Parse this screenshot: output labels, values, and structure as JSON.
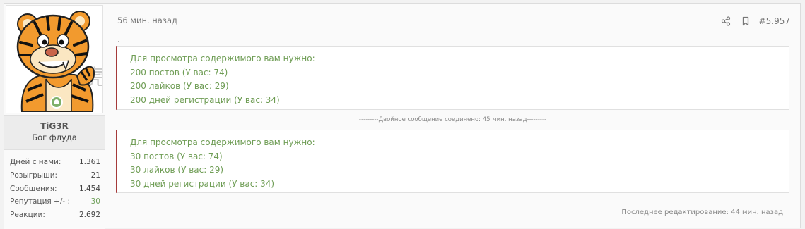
{
  "user": {
    "name": "TiG3R",
    "title": "Бог флуда",
    "online": true,
    "stats": [
      {
        "label": "Дней с нами:",
        "value": "1.361"
      },
      {
        "label": "Розыгрыши:",
        "value": "21"
      },
      {
        "label": "Сообщения:",
        "value": "1.454"
      },
      {
        "label": "Репутация +/- :",
        "value": "30",
        "color": "#6fa05a"
      },
      {
        "label": "Реакции:",
        "value": "2.692"
      }
    ]
  },
  "post": {
    "time": "56 мин. назад",
    "number": "#5.957",
    "dot": ".",
    "icons": [
      "share-icon",
      "bookmark-icon"
    ],
    "hidden_blocks": [
      {
        "lines": [
          "Для просмотра содержимого вам нужно:",
          "200 постов (У вас: 74)",
          "200 лайков (У вас: 29)",
          "200 дней регистрации (У вас: 34)"
        ]
      },
      {
        "lines": [
          "Для просмотра содержимого вам нужно:",
          "30 постов (У вас: 74)",
          "30 лайков (У вас: 29)",
          "30 дней регистрации (У вас: 34)"
        ]
      }
    ],
    "merge_note": "---------Двойное сообщение соединено: 45 мин. назад---------",
    "last_edited": "Последнее редактирование: 44 мин. назад"
  },
  "colors": {
    "hidden_text": "#6f9d55",
    "hidden_border": "#a53a3a",
    "online": "#7fb069"
  }
}
